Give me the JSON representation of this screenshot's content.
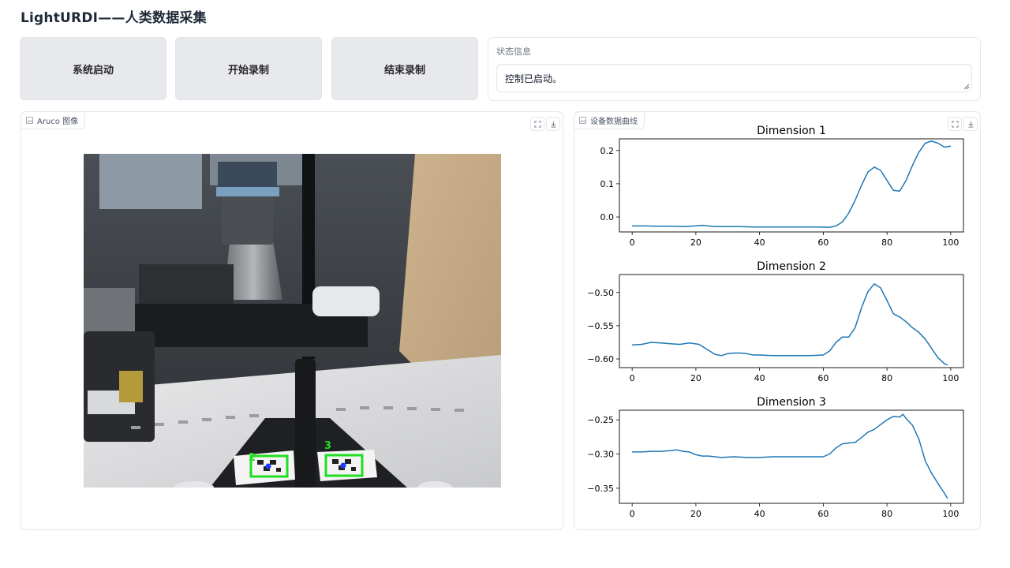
{
  "app": {
    "title": "LightURDI——人类数据采集"
  },
  "buttons": {
    "start_system": "系统启动",
    "start_record": "开始录制",
    "stop_record": "结束录制"
  },
  "status": {
    "label": "状态信息",
    "text": "控制已启动。"
  },
  "image_panel": {
    "label": "Aruco 图像",
    "marker_ids": [
      "2",
      "3"
    ]
  },
  "chart_panel": {
    "label": "设备数据曲线"
  },
  "colors": {
    "line": "#1f77b4",
    "button_bg": "#e8e9ec",
    "marker_box": "#22dd22"
  },
  "icons": {
    "image": "image-icon",
    "fullscreen": "fullscreen-icon",
    "download": "download-icon"
  },
  "chart_data": [
    {
      "type": "line",
      "title": "Dimension 1",
      "xlim": [
        -4,
        104
      ],
      "ylim": [
        -0.045,
        0.235
      ],
      "xticks": [
        0,
        20,
        40,
        60,
        80,
        100
      ],
      "yticks": [
        0.0,
        0.1,
        0.2
      ],
      "ytick_labels": [
        "0.0",
        "0.1",
        "0.2"
      ],
      "x": [
        0,
        4,
        8,
        12,
        16,
        20,
        22,
        26,
        30,
        34,
        38,
        42,
        46,
        50,
        54,
        58,
        62,
        64,
        66,
        68,
        70,
        72,
        74,
        76,
        78,
        80,
        82,
        84,
        86,
        88,
        90,
        92,
        94,
        96,
        98,
        100
      ],
      "y": [
        -0.027,
        -0.027,
        -0.028,
        -0.028,
        -0.029,
        -0.027,
        -0.025,
        -0.029,
        -0.029,
        -0.029,
        -0.03,
        -0.03,
        -0.03,
        -0.03,
        -0.03,
        -0.03,
        -0.031,
        -0.027,
        -0.015,
        0.012,
        0.05,
        0.095,
        0.135,
        0.15,
        0.14,
        0.11,
        0.08,
        0.078,
        0.11,
        0.155,
        0.195,
        0.222,
        0.228,
        0.222,
        0.21,
        0.213
      ]
    },
    {
      "type": "line",
      "title": "Dimension 2",
      "xlim": [
        -4,
        104
      ],
      "ylim": [
        -0.613,
        -0.473
      ],
      "xticks": [
        0,
        20,
        40,
        60,
        80,
        100
      ],
      "yticks": [
        -0.6,
        -0.55,
        -0.5
      ],
      "ytick_labels": [
        "−0.60",
        "−0.55",
        "−0.50"
      ],
      "x": [
        0,
        3,
        6,
        9,
        12,
        15,
        18,
        21,
        24,
        26,
        28,
        30,
        32,
        34,
        36,
        38,
        40,
        44,
        48,
        52,
        56,
        60,
        62,
        64,
        66,
        68,
        70,
        72,
        74,
        76,
        78,
        80,
        82,
        84,
        86,
        88,
        90,
        92,
        94,
        96,
        98,
        99
      ],
      "y": [
        -0.579,
        -0.578,
        -0.575,
        -0.576,
        -0.577,
        -0.578,
        -0.576,
        -0.578,
        -0.587,
        -0.593,
        -0.595,
        -0.592,
        -0.591,
        -0.591,
        -0.592,
        -0.594,
        -0.594,
        -0.595,
        -0.595,
        -0.595,
        -0.595,
        -0.594,
        -0.588,
        -0.575,
        -0.567,
        -0.567,
        -0.553,
        -0.523,
        -0.499,
        -0.487,
        -0.493,
        -0.512,
        -0.532,
        -0.537,
        -0.544,
        -0.553,
        -0.56,
        -0.57,
        -0.584,
        -0.598,
        -0.607,
        -0.609
      ]
    },
    {
      "type": "line",
      "title": "Dimension 3",
      "xlim": [
        -4,
        104
      ],
      "ylim": [
        -0.372,
        -0.236
      ],
      "xticks": [
        0,
        20,
        40,
        60,
        80,
        100
      ],
      "yticks": [
        -0.35,
        -0.3,
        -0.25
      ],
      "ytick_labels": [
        "−0.35",
        "−0.30",
        "−0.25"
      ],
      "x": [
        0,
        3,
        6,
        9,
        12,
        14,
        16,
        18,
        20,
        22,
        24,
        28,
        32,
        36,
        40,
        44,
        48,
        52,
        56,
        60,
        62,
        64,
        66,
        68,
        70,
        72,
        74,
        76,
        78,
        80,
        82,
        84,
        85,
        86,
        88,
        90,
        92,
        94,
        96,
        98,
        99
      ],
      "y": [
        -0.297,
        -0.297,
        -0.296,
        -0.296,
        -0.295,
        -0.294,
        -0.296,
        -0.297,
        -0.301,
        -0.303,
        -0.303,
        -0.305,
        -0.304,
        -0.305,
        -0.305,
        -0.304,
        -0.304,
        -0.304,
        -0.304,
        -0.304,
        -0.3,
        -0.291,
        -0.285,
        -0.284,
        -0.283,
        -0.276,
        -0.268,
        -0.264,
        -0.257,
        -0.25,
        -0.245,
        -0.246,
        -0.242,
        -0.248,
        -0.258,
        -0.278,
        -0.31,
        -0.328,
        -0.343,
        -0.357,
        -0.365
      ]
    }
  ]
}
